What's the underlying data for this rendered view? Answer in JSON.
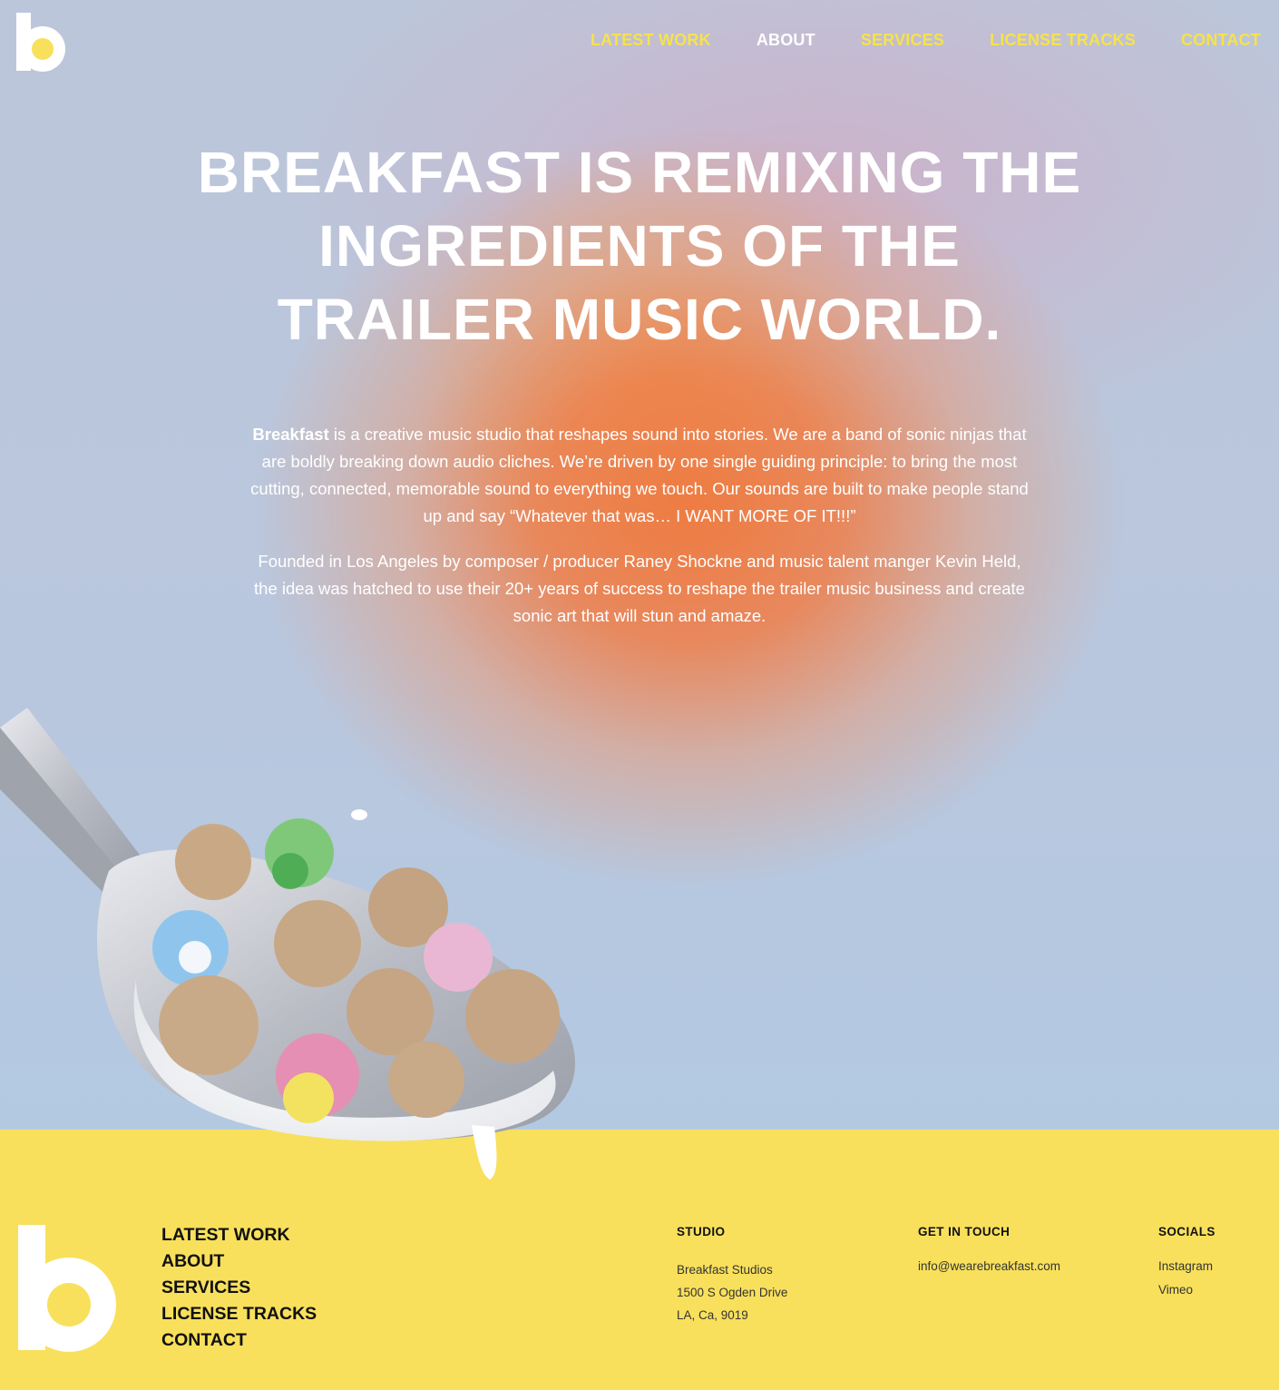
{
  "nav": {
    "items": [
      {
        "label": "LATEST WORK",
        "active": false
      },
      {
        "label": "ABOUT",
        "active": true
      },
      {
        "label": "SERVICES",
        "active": false
      },
      {
        "label": "LICENSE TRACKS",
        "active": false
      },
      {
        "label": "CONTACT",
        "active": false
      }
    ]
  },
  "hero": {
    "headline_lines": [
      "BREAKFAST IS REMIXING THE",
      "INGREDIENTS OF THE",
      "TRAILER MUSIC WORLD."
    ],
    "intro_bold": "Breakfast",
    "intro_p1": " is a creative music studio that reshapes sound into stories. We are a band of sonic ninjas that are boldly breaking down audio cliches.  We’re driven by one single guiding principle: to bring the most cutting, connected, memorable sound to everything we touch. Our sounds are built to make people stand up and say “Whatever that was… I WANT MORE OF IT!!!”",
    "intro_p2": "Founded in Los Angeles by composer / producer Raney Shockne and music talent manger Kevin Held, the idea was hatched to use their 20+ years of success to reshape the trailer music business and create sonic art that will stun and amaze."
  },
  "footer": {
    "nav": [
      "LATEST WORK",
      "ABOUT",
      "SERVICES",
      "LICENSE TRACKS",
      "CONTACT"
    ],
    "studio": {
      "heading": "STUDIO",
      "lines": [
        "Breakfast Studios",
        "1500 S Ogden Drive",
        "LA, Ca, 9019"
      ]
    },
    "touch": {
      "heading": "GET IN TOUCH",
      "email": "info@wearebreakfast.com"
    },
    "socials": {
      "heading": "SOCIALS",
      "links": [
        "Instagram",
        "Vimeo"
      ]
    }
  },
  "colors": {
    "accent_yellow": "#f5e34b",
    "footer_bg": "#f8e05c",
    "logo_dot": "#f8e05c"
  },
  "icons": {
    "header_logo": "breakfast-b-logo",
    "footer_logo": "breakfast-b-logo",
    "illustration": "cereal-spoon-image"
  }
}
